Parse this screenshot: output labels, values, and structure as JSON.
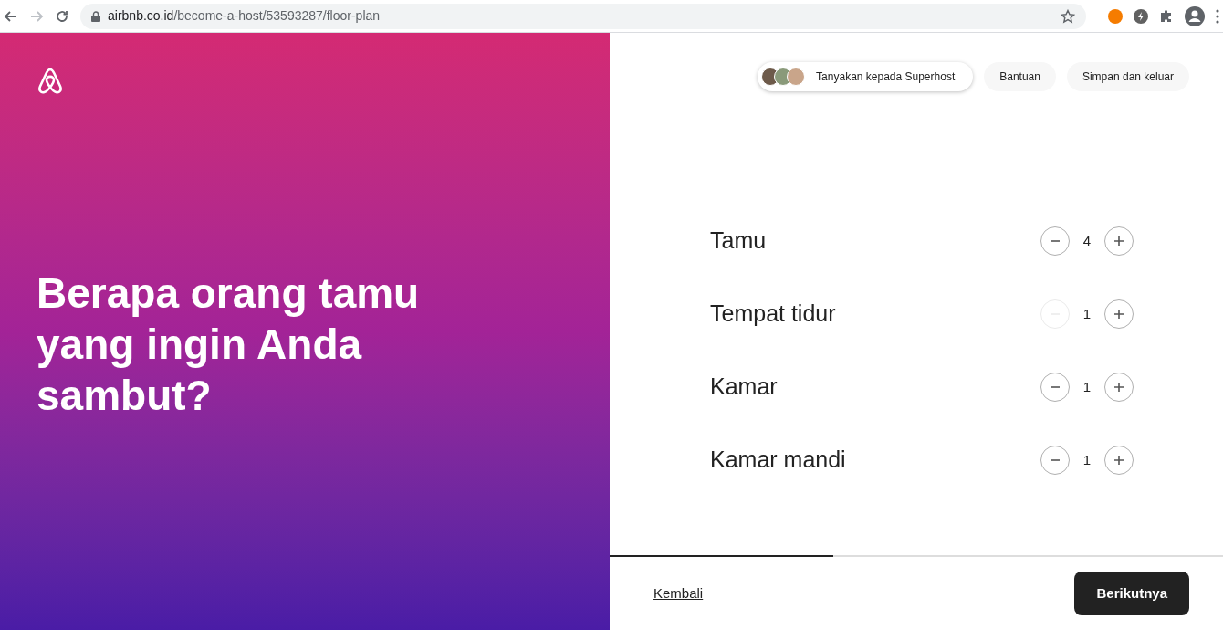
{
  "browser": {
    "url_host": "airbnb.co.id",
    "url_path": "/become-a-host/53593287/floor-plan"
  },
  "hero": {
    "title": "Berapa orang tamu yang ingin Anda sambut?"
  },
  "header_buttons": [
    {
      "kind": "superhost",
      "label": "Tanyakan kepada Superhost"
    },
    {
      "kind": "plain",
      "label": "Bantuan"
    },
    {
      "kind": "plain",
      "label": "Simpan dan keluar"
    }
  ],
  "counters": [
    {
      "label": "Tamu",
      "value": "4",
      "minus_disabled": false
    },
    {
      "label": "Tempat tidur",
      "value": "1",
      "minus_disabled": true
    },
    {
      "label": "Kamar",
      "value": "1",
      "minus_disabled": false
    },
    {
      "label": "Kamar mandi",
      "value": "1",
      "minus_disabled": false
    }
  ],
  "progress": {
    "level": 0.365
  },
  "footer": {
    "back": "Kembali",
    "next": "Berikutnya"
  }
}
